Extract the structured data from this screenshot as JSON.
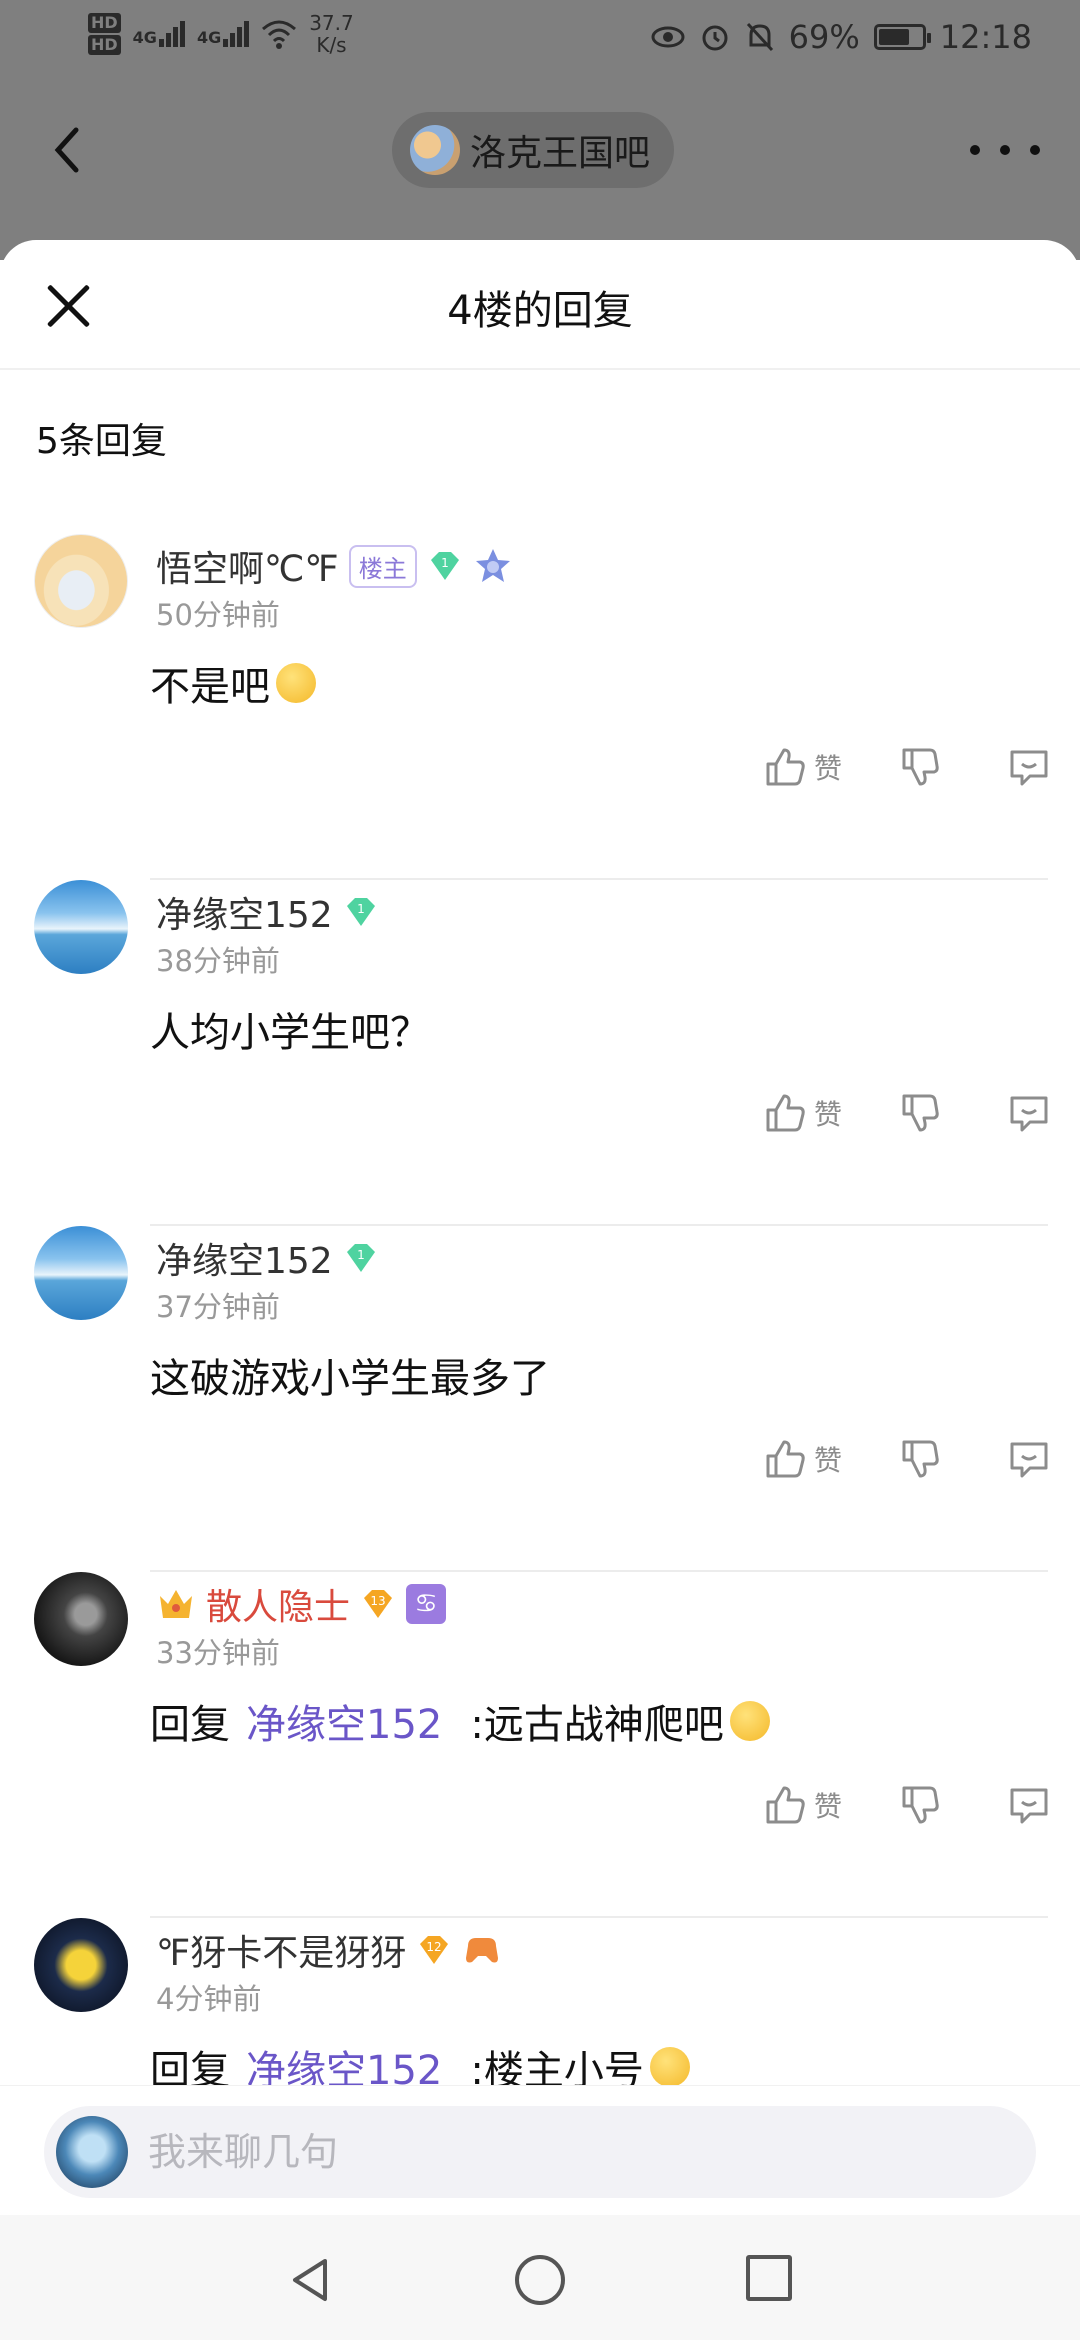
{
  "status_bar": {
    "speed_value": "37.7",
    "speed_unit": "K/s",
    "network_1": "4G",
    "network_2": "4G",
    "battery": "69%",
    "battery_level": 0.69,
    "time": "12:18"
  },
  "topbar": {
    "forum_name": "洛克王国吧"
  },
  "sheet": {
    "title": "4楼的回复",
    "reply_count": "5条回复"
  },
  "replies": [
    {
      "username": "悟空啊℃℉",
      "owner_badge": "楼主",
      "level": "1",
      "time": "50分钟前",
      "content": "不是吧",
      "like_label": "赞"
    },
    {
      "username": "净缘空152",
      "level": "1",
      "time": "38分钟前",
      "content": "人均小学生吧？",
      "like_label": "赞"
    },
    {
      "username": "净缘空152",
      "level": "1",
      "time": "37分钟前",
      "content": "这破游戏小学生最多了",
      "like_label": "赞"
    },
    {
      "username": "散人隐士",
      "level": "13",
      "time": "33分钟前",
      "reply_prefix": "回复",
      "mention": "净缘空152",
      "content": ":远古战神爬吧",
      "like_label": "赞"
    },
    {
      "username": "℉犽卡不是犽犽",
      "level": "12",
      "time": "4分钟前",
      "reply_prefix": "回复",
      "mention": "净缘空152",
      "content": ":楼主小号"
    }
  ],
  "input": {
    "placeholder": "我来聊几句"
  },
  "colors": {
    "accent": "#6a56c8",
    "vip_name": "#d94a3d",
    "gem_green": "#4fd3a0",
    "gem_orange": "#f5a623"
  }
}
